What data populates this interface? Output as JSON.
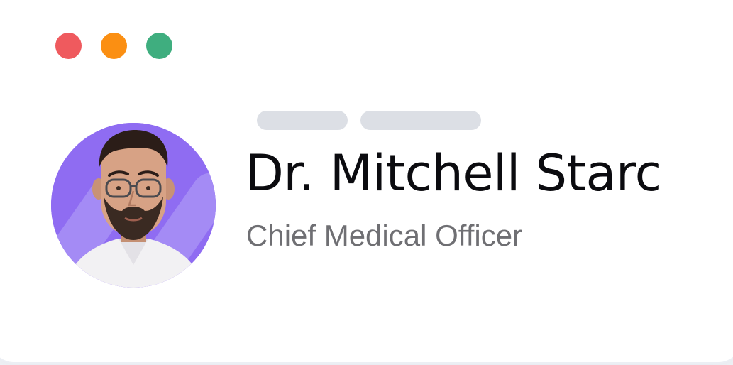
{
  "window": {
    "controls": [
      {
        "name": "close",
        "color": "#ef5a5e"
      },
      {
        "name": "minimize",
        "color": "#fb8f12"
      },
      {
        "name": "maximize",
        "color": "#3fae7f"
      }
    ]
  },
  "profile": {
    "name": "Dr. Mitchell Starc",
    "role": "Chief Medical Officer",
    "avatar_background": "#8f6cf2"
  }
}
